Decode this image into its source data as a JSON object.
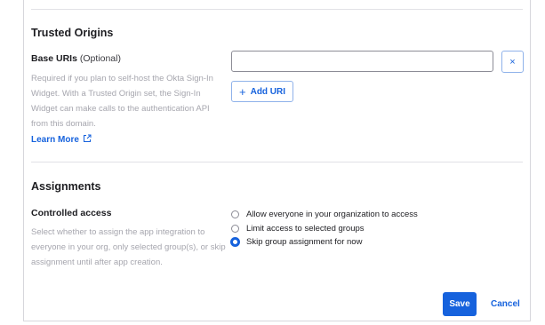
{
  "trusted_origins": {
    "title": "Trusted Origins",
    "base_uris_label": "Base URIs",
    "base_uris_optional": "(Optional)",
    "help_text": "Required if you plan to self-host the Okta Sign-In Widget. With a Trusted Origin set, the Sign-In Widget can make calls to the authentication API from this domain.",
    "learn_more": "Learn More",
    "uri_value": "",
    "remove_label": "×",
    "add_uri_label": "Add URI",
    "add_uri_plus": "+"
  },
  "assignments": {
    "title": "Assignments",
    "controlled_access_label": "Controlled access",
    "help_text": "Select whether to assign the app integration to everyone in your org, only selected group(s), or skip assignment until after app creation.",
    "options": [
      {
        "label": "Allow everyone in your organization to access",
        "checked": false
      },
      {
        "label": "Limit access to selected groups",
        "checked": false
      },
      {
        "label": "Skip group assignment for now",
        "checked": true
      }
    ]
  },
  "actions": {
    "save": "Save",
    "cancel": "Cancel"
  },
  "colors": {
    "accent": "#1662dd",
    "muted_text": "#a6a6ae"
  }
}
